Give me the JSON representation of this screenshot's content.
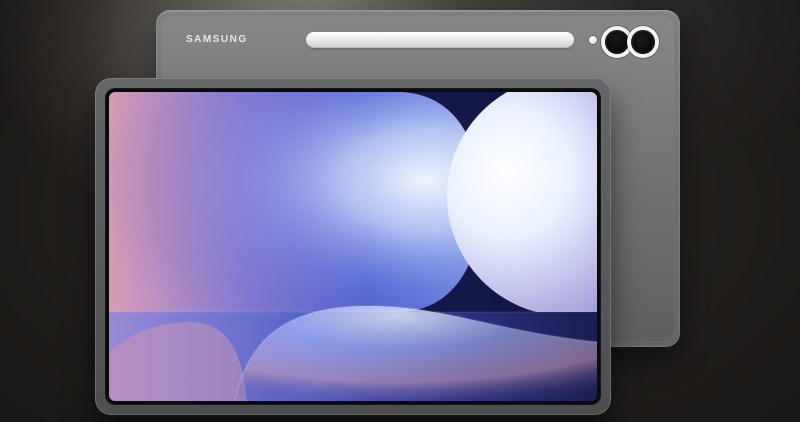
{
  "scene": {
    "background_color": "#1b1917"
  },
  "tablet_back": {
    "brand_text": "SAMSUNG",
    "color": "#6f7072"
  },
  "tablet_front": {
    "bezel_color": "#0b0b0b",
    "frame_color": "#595a5c"
  },
  "wallpaper": {
    "dominant_colors": [
      "#1b1f63",
      "#6e82d6",
      "#d7e7ff",
      "#d8a0b6"
    ]
  }
}
